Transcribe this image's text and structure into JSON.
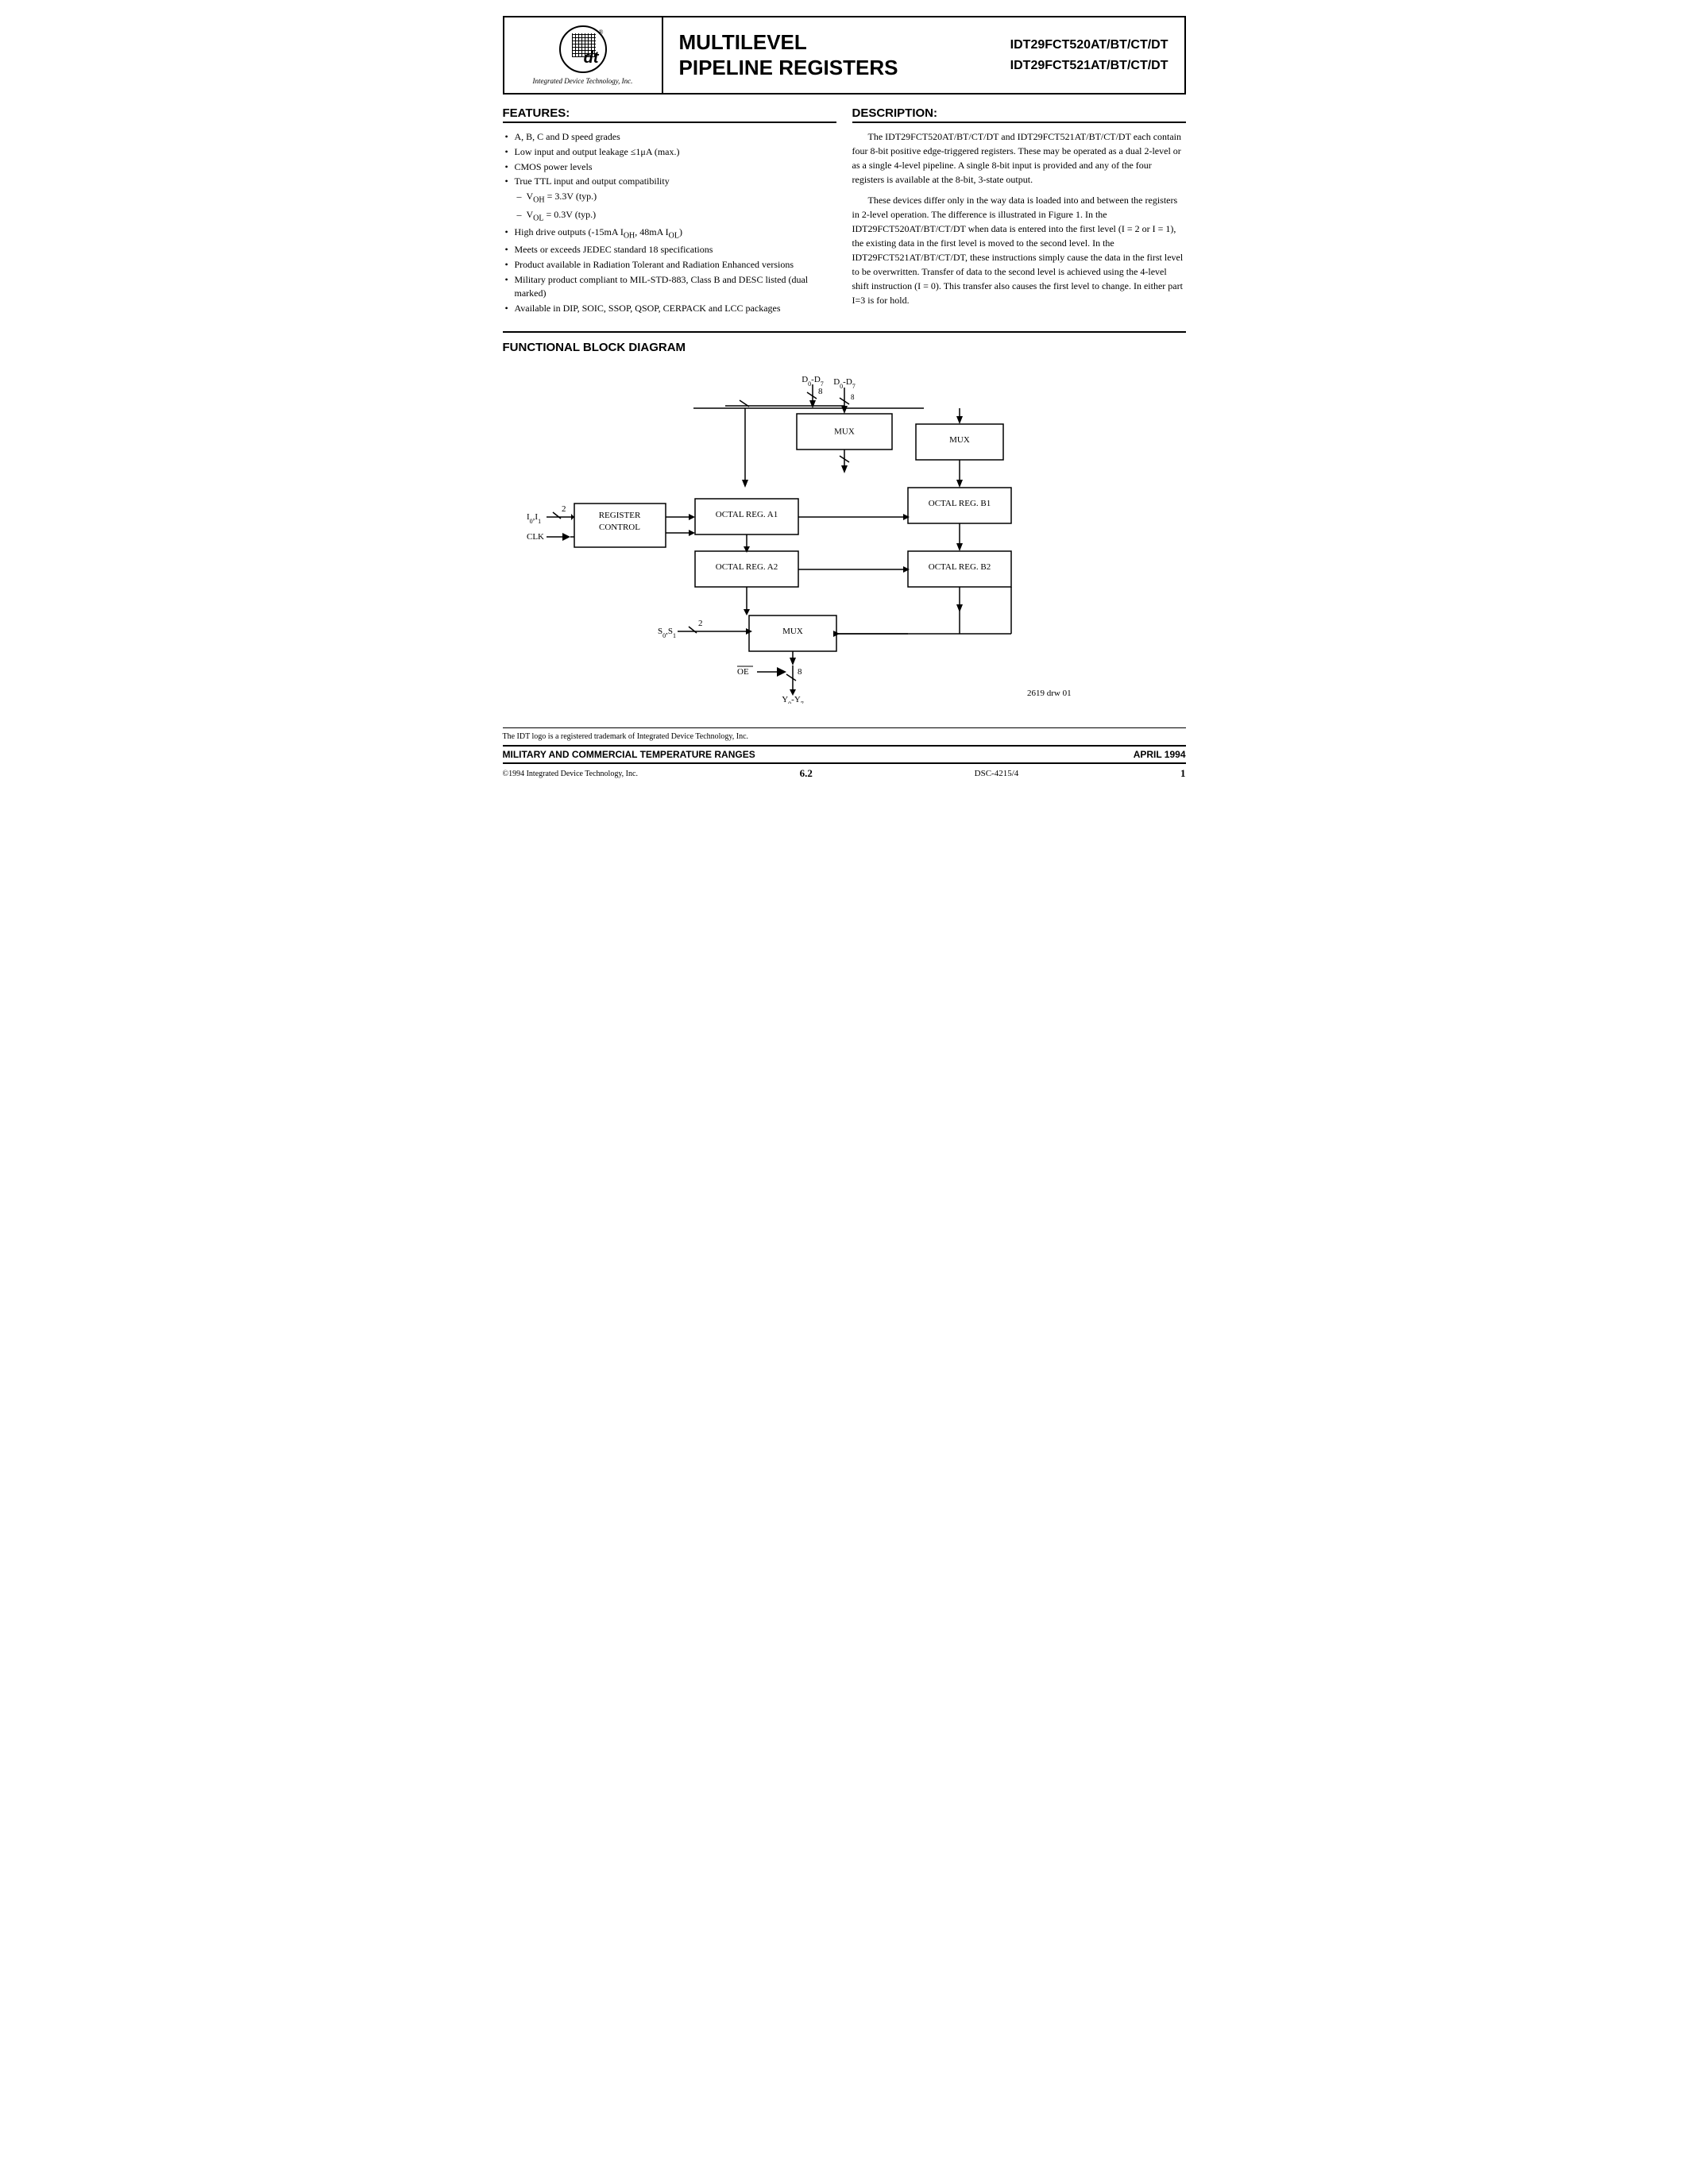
{
  "header": {
    "title_line1": "MULTILEVEL",
    "title_line2": "PIPELINE REGISTERS",
    "part_line1": "IDT29FCT520AT/BT/CT/DT",
    "part_line2": "IDT29FCT521AT/BT/CT/DT",
    "logo_company": "Integrated Device Technology, Inc."
  },
  "features": {
    "title": "FEATURES:",
    "items": [
      {
        "text": "A, B, C and D speed grades",
        "indent": false
      },
      {
        "text": "Low input and output leakage ≤1μA (max.)",
        "indent": false
      },
      {
        "text": "CMOS power levels",
        "indent": false
      },
      {
        "text": "True TTL input and output compatibility",
        "indent": false
      },
      {
        "text": "VᴏH = 3.3V (typ.)",
        "indent": true
      },
      {
        "text": "VᴏL = 0.3V (typ.)",
        "indent": true
      },
      {
        "text": "High drive outputs (-15mA IᴏH, 48mA IᴏL)",
        "indent": false
      },
      {
        "text": "Meets or exceeds JEDEC standard 18 specifications",
        "indent": false
      },
      {
        "text": "Product available in Radiation Tolerant and Radiation Enhanced versions",
        "indent": false
      },
      {
        "text": "Military product compliant to MIL-STD-883, Class B and DESC listed (dual marked)",
        "indent": false
      },
      {
        "text": "Available in DIP, SOIC, SSOP, QSOP, CERPACK and LCC packages",
        "indent": false
      }
    ]
  },
  "description": {
    "title": "DESCRIPTION:",
    "para1": "The IDT29FCT520AT/BT/CT/DT and IDT29FCT521AT/BT/CT/DT each contain four 8-bit positive edge-triggered registers. These may be operated as a dual 2-level or as a single 4-level pipeline. A single 8-bit input is provided and any of the four registers is available at the 8-bit, 3-state output.",
    "para2": "These devices differ only in the way data is loaded into and between the registers in 2-level operation. The difference is illustrated in Figure 1. In the IDT29FCT520AT/BT/CT/DT when data is entered into the first level (I = 2 or I = 1), the existing data in the first level is moved to the second level. In the IDT29FCT521AT/BT/CT/DT, these instructions simply cause the data in the first level to be overwritten. Transfer of data to the second level is achieved using the 4-level shift instruction (I = 0). This transfer also causes the first level to change. In either part I=3 is for hold."
  },
  "fbd": {
    "title": "FUNCTIONAL BLOCK DIAGRAM",
    "blocks": {
      "mux_top": "MUX",
      "octal_a1": "OCTAL REG. A1",
      "octal_a2": "OCTAL REG. A2",
      "octal_b1": "OCTAL REG. B1",
      "octal_b2": "OCTAL REG. B2",
      "reg_control": "REGISTER\nCONTROL",
      "mux_bottom": "MUX"
    },
    "signals": {
      "d0d7": "D₀-D₇",
      "io_i1": "I₀,I₁",
      "clk": "CLK",
      "s0s1": "S₀,S₁",
      "oe": "OE",
      "y0y7": "Y₀-Y₇",
      "bus_width_8": "8",
      "bus_width_2_io": "2",
      "bus_width_2_s": "2"
    },
    "drw_note": "2619 drw 01"
  },
  "footer": {
    "trademark_text": "The IDT logo is a registered trademark of Integrated Device Technology, Inc.",
    "mil_text": "MILITARY AND COMMERCIAL TEMPERATURE RANGES",
    "date_text": "APRIL 1994",
    "copyright": "©1994 Integrated Device Technology, Inc.",
    "page_num": "6.2",
    "doc_num": "DSC-4215/4",
    "page_right": "1"
  }
}
